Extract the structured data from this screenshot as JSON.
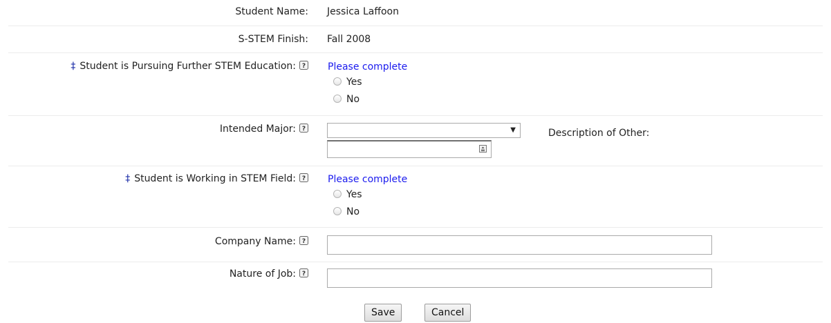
{
  "form": {
    "student_name": {
      "label": "Student Name:",
      "value": "Jessica Laffoon"
    },
    "sstem_finish": {
      "label": "S-STEM Finish:",
      "value": "Fall 2008"
    },
    "further_education": {
      "required_marker": "‡",
      "label": "Student is Pursuing Further STEM Education:",
      "help_icon": "question-help-icon",
      "prompt": "Please complete",
      "options": [
        "Yes",
        "No"
      ]
    },
    "intended_major": {
      "label": "Intended Major:",
      "help_icon": "question-help-icon",
      "selected_value": "",
      "dropdown_arrow": "▼",
      "other_label": "Description of Other:",
      "other_value": ""
    },
    "working_in_stem": {
      "required_marker": "‡",
      "label": "Student is Working in STEM Field:",
      "help_icon": "question-help-icon",
      "prompt": "Please complete",
      "options": [
        "Yes",
        "No"
      ]
    },
    "company_name": {
      "label": "Company Name:",
      "help_icon": "question-help-icon",
      "value": ""
    },
    "nature_of_job": {
      "label": "Nature of Job:",
      "help_icon": "question-help-icon",
      "value": ""
    }
  },
  "buttons": {
    "save": "Save",
    "cancel": "Cancel"
  }
}
